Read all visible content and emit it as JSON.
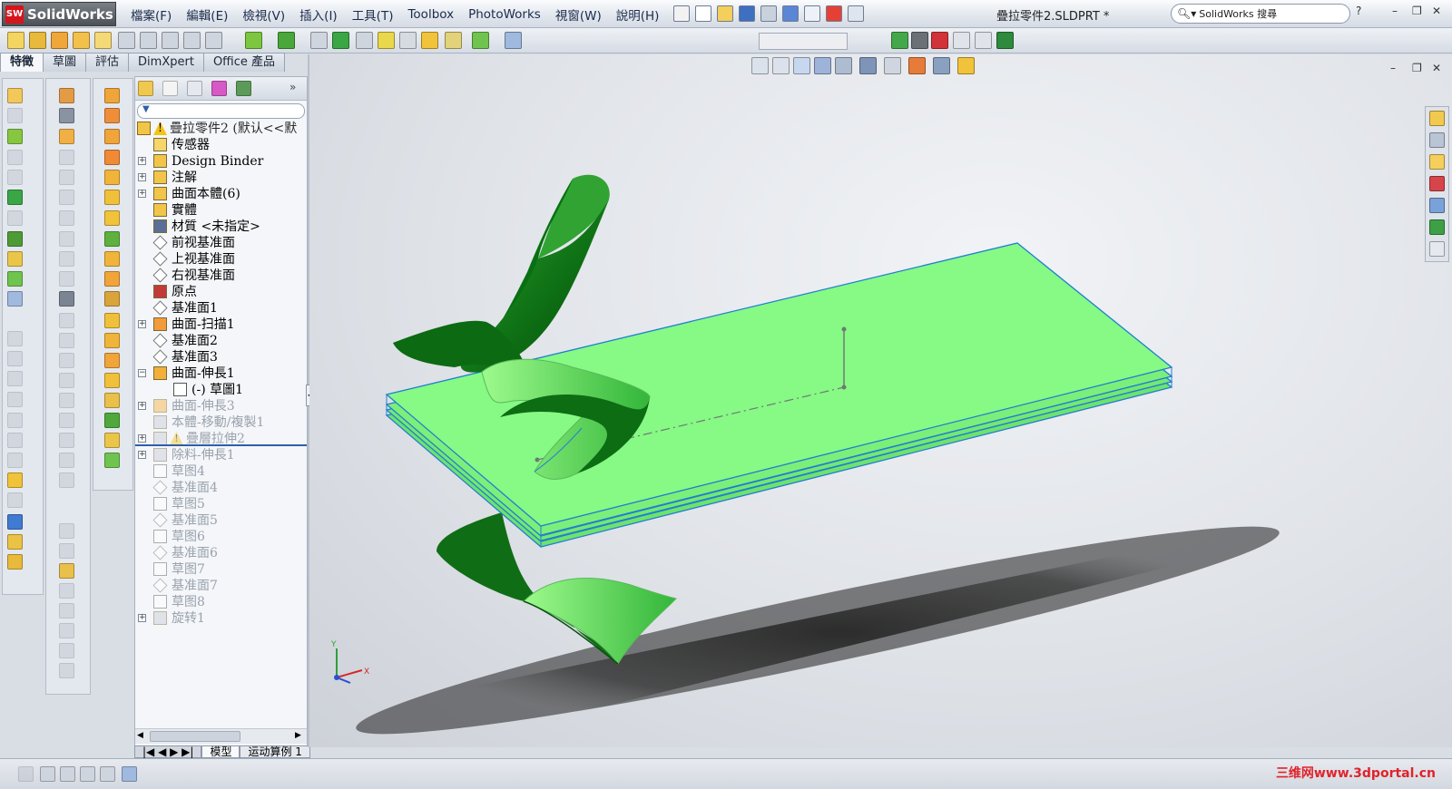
{
  "app": {
    "brand": "SolidWorks",
    "logo_letters": "SW"
  },
  "menu": [
    "檔案(F)",
    "編輯(E)",
    "檢視(V)",
    "插入(I)",
    "工具(T)",
    "Toolbox",
    "PhotoWorks",
    "視窗(W)",
    "說明(H)"
  ],
  "document_title": "疊拉零件2.SLDPRT *",
  "search": {
    "label": "SolidWorks 搜尋"
  },
  "window_controls": {
    "help": "?",
    "minimize": "–",
    "restore": "❐",
    "close": "✕"
  },
  "tabs": [
    {
      "label": "特徵",
      "active": true
    },
    {
      "label": "草圖",
      "active": false
    },
    {
      "label": "評估",
      "active": false
    },
    {
      "label": "DimXpert",
      "active": false
    },
    {
      "label": "Office 產品",
      "active": false
    }
  ],
  "feature_tree": {
    "root": "疊拉零件2 (默认<<默",
    "items": [
      {
        "label": "传感器",
        "icon": "sensor-icon",
        "expand": "",
        "suppressed": false
      },
      {
        "label": "Design Binder",
        "icon": "design-binder-icon",
        "expand": "+",
        "suppressed": false
      },
      {
        "label": "注解",
        "icon": "annotation-icon",
        "expand": "+",
        "suppressed": false
      },
      {
        "label": "曲面本體(6)",
        "icon": "surface-bodies-icon",
        "expand": "+",
        "suppressed": false
      },
      {
        "label": "實體",
        "icon": "solid-bodies-icon",
        "expand": "",
        "suppressed": false
      },
      {
        "label": "材質 <未指定>",
        "icon": "material-icon",
        "expand": "",
        "suppressed": false
      },
      {
        "label": "前视基准面",
        "icon": "plane-icon",
        "expand": "",
        "suppressed": false
      },
      {
        "label": "上视基准面",
        "icon": "plane-icon",
        "expand": "",
        "suppressed": false
      },
      {
        "label": "右视基准面",
        "icon": "plane-icon",
        "expand": "",
        "suppressed": false
      },
      {
        "label": "原点",
        "icon": "origin-icon",
        "expand": "",
        "suppressed": false
      },
      {
        "label": "基准面1",
        "icon": "plane-icon",
        "expand": "",
        "suppressed": false
      },
      {
        "label": "曲面-扫描1",
        "icon": "surface-sweep-icon",
        "expand": "+",
        "suppressed": false
      },
      {
        "label": "基准面2",
        "icon": "plane-icon",
        "expand": "",
        "suppressed": false
      },
      {
        "label": "基准面3",
        "icon": "plane-icon",
        "expand": "",
        "suppressed": false
      },
      {
        "label": "曲面-伸長1",
        "icon": "surface-extrude-icon",
        "expand": "−",
        "suppressed": false
      },
      {
        "label": "(-) 草圖1",
        "icon": "sketch-icon",
        "expand": "",
        "suppressed": false,
        "child": true
      },
      {
        "label": "曲面-伸長3",
        "icon": "surface-extrude-icon",
        "expand": "+",
        "suppressed": true
      },
      {
        "label": "本體-移動/複製1",
        "icon": "move-copy-icon",
        "expand": "",
        "suppressed": true
      },
      {
        "label": "疊層拉伸2",
        "icon": "loft-icon",
        "expand": "+",
        "suppressed": true
      },
      {
        "label": "除料-伸長1",
        "icon": "cut-extrude-icon",
        "expand": "+",
        "suppressed": true
      },
      {
        "label": "草图4",
        "icon": "sketch-icon",
        "expand": "",
        "suppressed": true
      },
      {
        "label": "基准面4",
        "icon": "plane-icon",
        "expand": "",
        "suppressed": true
      },
      {
        "label": "草图5",
        "icon": "sketch-icon",
        "expand": "",
        "suppressed": true
      },
      {
        "label": "基准面5",
        "icon": "plane-icon",
        "expand": "",
        "suppressed": true
      },
      {
        "label": "草图6",
        "icon": "sketch-icon",
        "expand": "",
        "suppressed": true
      },
      {
        "label": "基准面6",
        "icon": "plane-icon",
        "expand": "",
        "suppressed": true
      },
      {
        "label": "草图7",
        "icon": "sketch-icon",
        "expand": "",
        "suppressed": true
      },
      {
        "label": "基准面7",
        "icon": "plane-icon",
        "expand": "",
        "suppressed": true
      },
      {
        "label": "草图8",
        "icon": "sketch-icon",
        "expand": "",
        "suppressed": true
      },
      {
        "label": "旋转1",
        "icon": "revolve-icon",
        "expand": "+",
        "suppressed": true
      }
    ]
  },
  "bottom_tabs": [
    "模型",
    "运动算例 1"
  ],
  "triad": {
    "x": "X",
    "y": "Y"
  },
  "watermark": "三维网www.3dportal.cn",
  "colors": {
    "surface_light": "#87f985",
    "surface_dark": "#0d6d13",
    "edge": "#1f7fd0",
    "warning": "#f2c418"
  }
}
